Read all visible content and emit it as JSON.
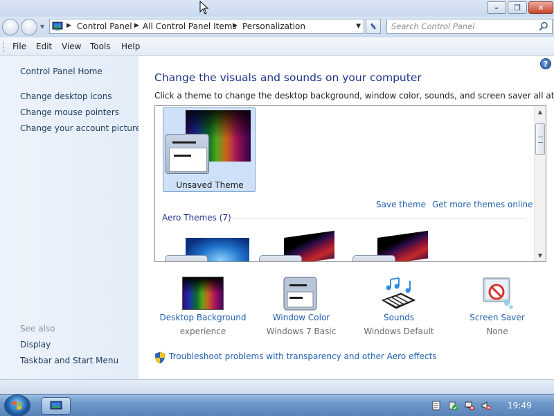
{
  "window": {
    "minimize_glyph": "–",
    "maximize_glyph": "❐",
    "close_glyph": "✕"
  },
  "address_bar": {
    "breadcrumbs": [
      "Control Panel",
      "All Control Panel Items",
      "Personalization"
    ]
  },
  "search": {
    "placeholder": "Search Control Panel"
  },
  "menu": {
    "file": "File",
    "edit": "Edit",
    "view": "View",
    "tools": "Tools",
    "help": "Help"
  },
  "sidebar": {
    "home": "Control Panel Home",
    "links": [
      "Change desktop icons",
      "Change mouse pointers",
      "Change your account picture"
    ],
    "see_also_label": "See also",
    "see_also_links": [
      "Display",
      "Taskbar and Start Menu"
    ]
  },
  "main": {
    "help_glyph": "?",
    "title": "Change the visuals and sounds on your computer",
    "subtitle": "Click a theme to change the desktop background, window color, sounds, and screen saver all at once.",
    "selected_theme": "Unsaved Theme",
    "save_theme": "Save theme",
    "get_more_themes": "Get more themes online",
    "aero_group": "Aero Themes (7)",
    "tiles": [
      {
        "name": "Desktop Background",
        "value": "experience",
        "icon": "desktop-background-icon"
      },
      {
        "name": "Window Color",
        "value": "Windows 7 Basic",
        "icon": "window-color-icon"
      },
      {
        "name": "Sounds",
        "value": "Windows Default",
        "icon": "sounds-icon"
      },
      {
        "name": "Screen Saver",
        "value": "None",
        "icon": "screen-saver-icon"
      }
    ],
    "troubleshoot_link": "Troubleshoot problems with transparency and other Aero effects"
  },
  "taskbar": {
    "clock": "19:49"
  }
}
